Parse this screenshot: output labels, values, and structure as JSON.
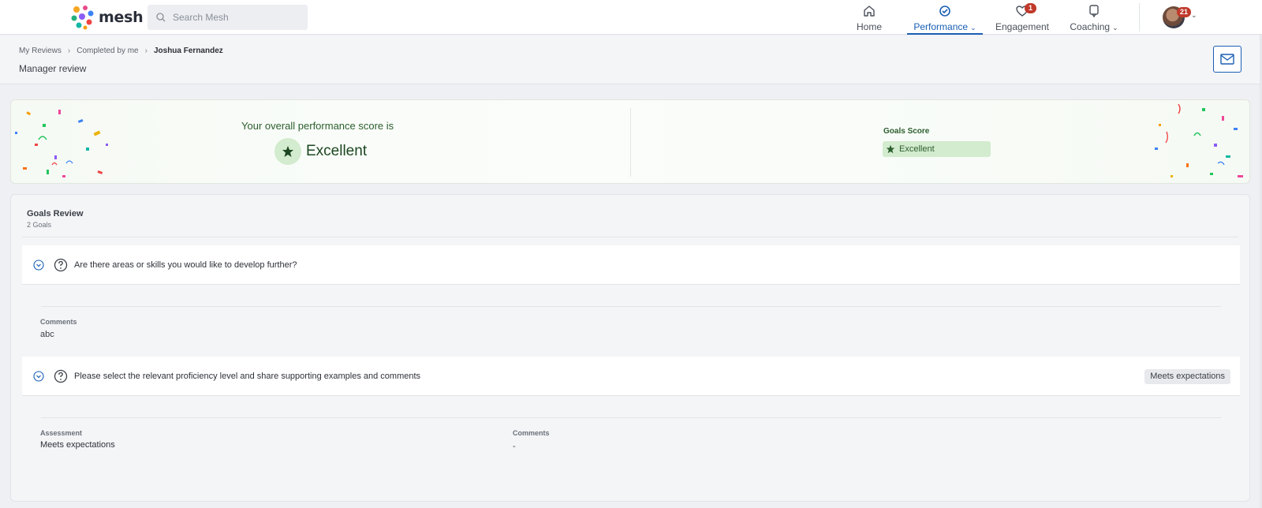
{
  "app": {
    "logo_text": "mesh"
  },
  "search": {
    "placeholder": "Search Mesh"
  },
  "nav": {
    "home": "Home",
    "performance": "Performance",
    "engagement": "Engagement",
    "engagement_badge": "1",
    "coaching": "Coaching",
    "avatar_badge": "21"
  },
  "breadcrumb": {
    "items": [
      "My Reviews",
      "Completed by me",
      "Joshua Fernandez"
    ],
    "separator": "›"
  },
  "page": {
    "title": "Manager review"
  },
  "score": {
    "label": "Your overall performance score is",
    "value": "Excellent",
    "goals_label": "Goals Score",
    "goals_value": "Excellent",
    "accent": "#2c5e2e"
  },
  "goals_review": {
    "title": "Goals Review",
    "subtitle": "2 Goals",
    "questions": [
      {
        "text": "Are there areas or skills you would like to develop further?",
        "comments_label": "Comments",
        "comments_value": "abc"
      },
      {
        "text": "Please select the relevant proficiency level and share supporting examples and comments",
        "badge": "Meets expectations",
        "assessment_label": "Assessment",
        "assessment_value": "Meets expectations",
        "comments_label": "Comments",
        "comments_value": "-"
      }
    ]
  },
  "colors": {
    "primary": "#1a5fb4",
    "badge_red": "#c0392b",
    "success_bg": "#d3ebce"
  }
}
